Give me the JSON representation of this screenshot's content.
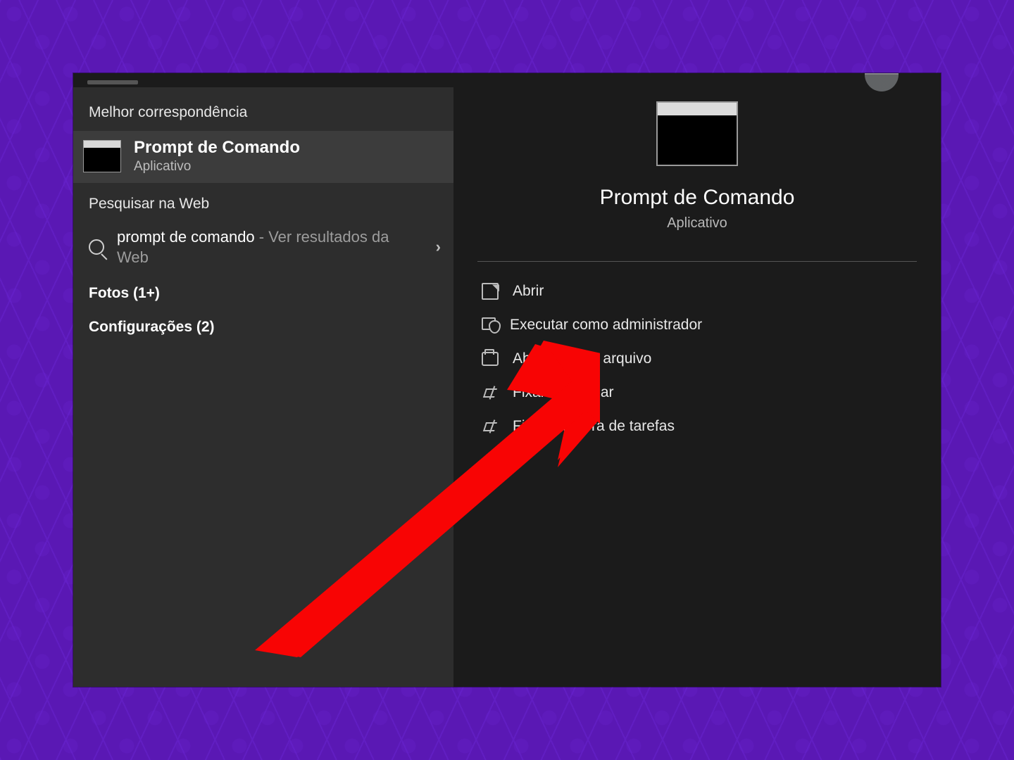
{
  "left": {
    "best_header": "Melhor correspondência",
    "best_title": "Prompt de Comando",
    "best_sub": "Aplicativo",
    "web_header": "Pesquisar na Web",
    "web_query": "prompt de comando",
    "web_suffix": " - Ver resultados da Web",
    "cat_photos": "Fotos (1+)",
    "cat_settings": "Configurações (2)"
  },
  "right": {
    "title": "Prompt de Comando",
    "sub": "Aplicativo",
    "actions": {
      "open": "Abrir",
      "admin": "Executar como administrador",
      "location": "Abrir local do arquivo",
      "pin_start": "Fixar em Iniciar",
      "pin_taskbar": "Fixar na barra de tarefas"
    }
  }
}
